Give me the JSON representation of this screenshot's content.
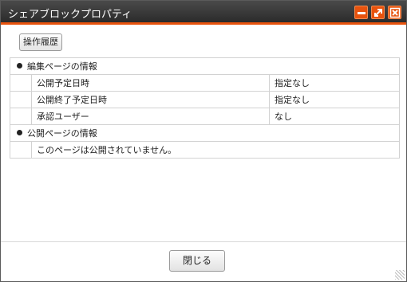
{
  "window": {
    "title": "シェアブロックプロパティ",
    "accent_color": "#e8530e",
    "titlebar_color": "#333333",
    "controls": [
      "minimize-icon",
      "maximize-icon",
      "close-icon"
    ]
  },
  "toolbar": {
    "history_label": "操作履歴"
  },
  "edit_section": {
    "heading": "編集ページの情報",
    "rows": [
      {
        "label": "公開予定日時",
        "value": "指定なし"
      },
      {
        "label": "公開終了予定日時",
        "value": "指定なし"
      },
      {
        "label": "承認ユーザー",
        "value": "なし"
      }
    ]
  },
  "public_section": {
    "heading": "公開ページの情報",
    "message": "このページは公開されていません。"
  },
  "footer": {
    "close_label": "閉じる"
  }
}
